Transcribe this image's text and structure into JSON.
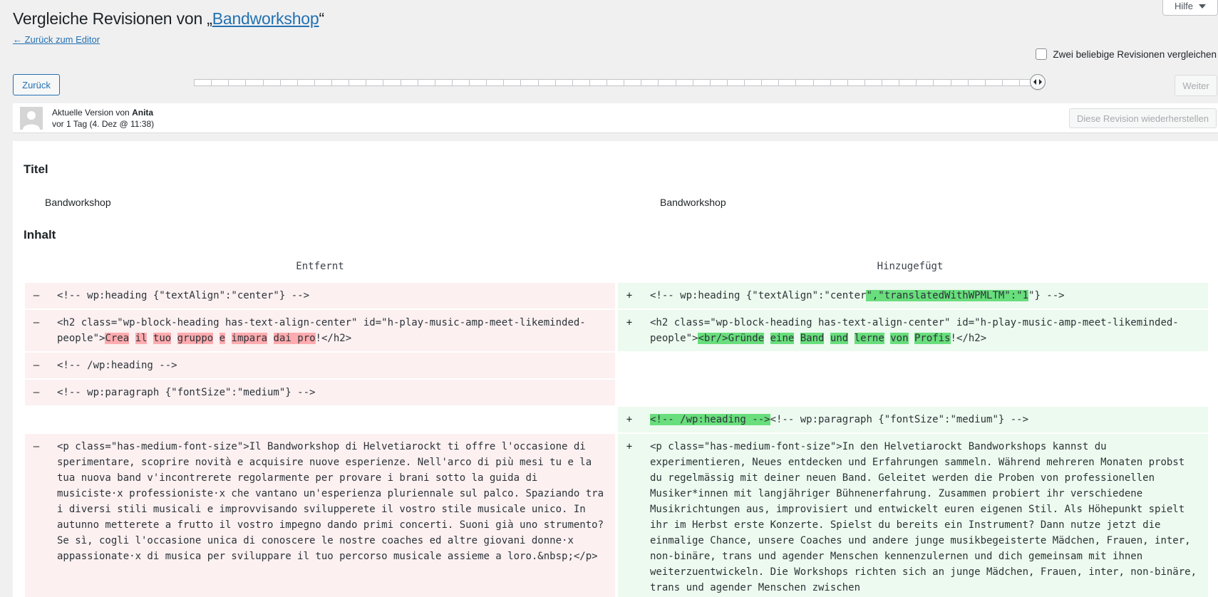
{
  "header": {
    "title_prefix": "Vergleiche Revisionen von „",
    "post_title": "Bandworkshop",
    "title_suffix": "“",
    "back_link": "← Zurück zum Editor",
    "help_tab": "Hilfe",
    "compare_two_label": "Zwei beliebige Revisionen vergleichen"
  },
  "slider": {
    "prev_label": "Zurück",
    "next_label": "Weiter",
    "revision_count": 49,
    "current_position": 1.0
  },
  "meta": {
    "current_version_prefix": "Aktuelle Version von",
    "author": "Anita",
    "time": "vor 1 Tag (4. Dez @ 11:38)",
    "restore_label": "Diese Revision wiederherstellen"
  },
  "diff": {
    "title_heading": "Titel",
    "title_left": "Bandworkshop",
    "title_right": "Bandworkshop",
    "content_heading": "Inhalt",
    "removed_header": "Entfernt",
    "added_header": "Hinzugefügt",
    "rows": {
      "r1": {
        "left_sign": "–",
        "left": "<!-- wp:heading {\"textAlign\":\"center\"} -->",
        "right_sign": "+",
        "right_pre": "<!-- wp:heading {\"textAlign\":\"center",
        "right_hl": "\",\"translatedWithWPMLTM\":\"1",
        "right_post": "\"} -->"
      },
      "r2": {
        "left_sign": "–",
        "left_pre": "<h2 class=\"wp-block-heading has-text-align-center\" id=\"h-play-music-amp-meet-likeminded-people\">",
        "left_w1": "Crea",
        "left_w2": "il",
        "left_w3": "tuo",
        "left_w4": "gruppo",
        "left_w5": "e",
        "left_w6": "impara",
        "left_w7": "dai pro",
        "left_post": "!</h2>",
        "right_sign": "+",
        "right_pre": "<h2 class=\"wp-block-heading has-text-align-center\" id=\"h-play-music-amp-meet-likeminded-people\">",
        "right_w1": "<br/>Gründe",
        "right_w2": "eine",
        "right_w3": "Band",
        "right_w4": "und",
        "right_w5": "lerne",
        "right_w6": "von",
        "right_w7": "Profis",
        "right_post": "!</h2>"
      },
      "r3": {
        "left_sign": "–",
        "left": "<!-- /wp:heading -->"
      },
      "r4": {
        "left_sign": "–",
        "left": "<!-- wp:paragraph {\"fontSize\":\"medium\"} -->"
      },
      "r5": {
        "right_sign": "+",
        "right_hl": "<!-- /wp:heading -->",
        "right_post": "<!-- wp:paragraph {\"fontSize\":\"medium\"} -->"
      },
      "r6": {
        "left_sign": "–",
        "left": "<p class=\"has-medium-font-size\">Il Bandworkshop di Helvetiarockt ti offre l'occasione di sperimentare, scoprire novità e acquisire nuove esperienze. Nell'arco di più mesi tu e la tua nuova band v'incontrerete regolarmente per provare i brani sotto la guida di musiciste·x professioniste·x che vantano un'esperienza pluriennale sul palco. Spaziando tra i diversi stili musicali e improvvisando svilupperete il vostro stile musicale unico. In autunno metterete a frutto il vostro impegno dando primi concerti. Suoni già uno strumento? Se sì, cogli l'occasione unica di conoscere le nostre coaches ed altre giovani donne·x appassionate·x di musica per sviluppare il tuo percorso musicale assieme a loro.&nbsp;</p>",
        "right_sign": "+",
        "right": "<p class=\"has-medium-font-size\">In den Helvetiarockt Bandworkshops kannst du experimentieren, Neues entdecken und Erfahrungen sammeln. Während mehreren Monaten probst du regelmässig mit deiner neuen Band. Geleitet werden die Proben von professionellen Musiker*innen mit langjähriger Bühnenerfahrung. Zusammen probiert ihr verschiedene Musikrichtungen aus, improvisiert und entwickelt euren eigenen Stil. Als Höhepunkt spielt ihr im Herbst erste Konzerte. Spielst du bereits ein Instrument? Dann nutze jetzt die einmalige Chance, unsere Coaches und andere junge musikbegeisterte Mädchen, Frauen, inter, non-binäre, trans und agender Menschen kennenzulernen und dich gemeinsam mit ihnen weiterzuentwickeln. Die Workshops richten sich an junge Mädchen, Frauen, inter, non-binäre, trans und agender Menschen zwischen"
      }
    }
  },
  "colors": {
    "link": "#2271b1",
    "removed_bg": "#fcf0f1",
    "removed_highlight": "#ffabaf",
    "added_bg": "#edfaef",
    "added_highlight": "#68de7c"
  }
}
